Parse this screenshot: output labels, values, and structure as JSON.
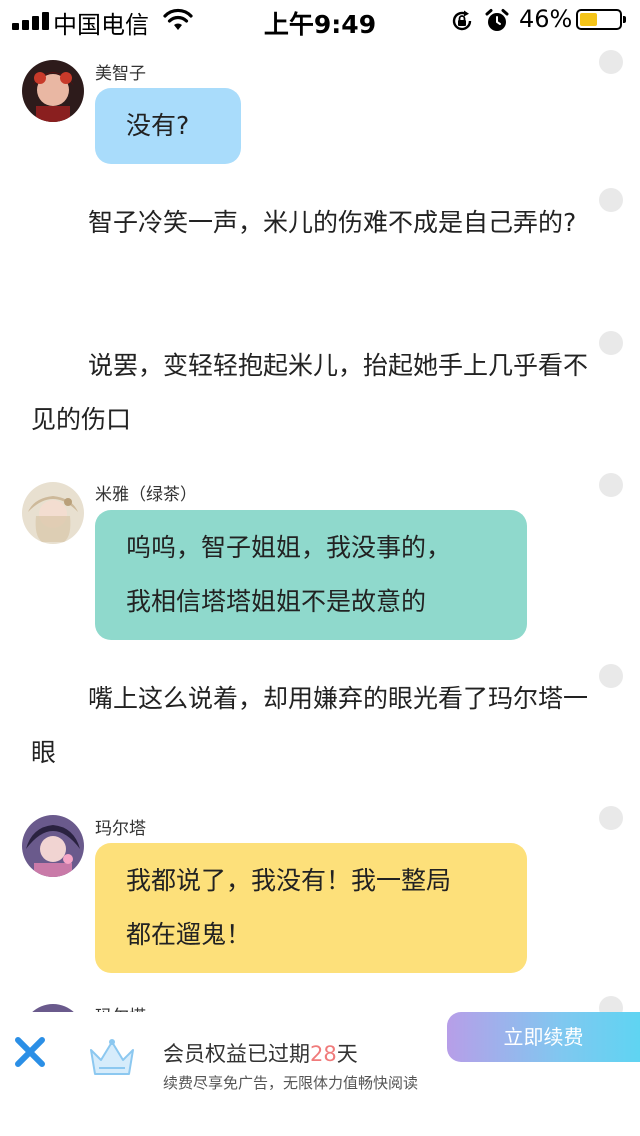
{
  "status_bar": {
    "carrier": "中国电信",
    "time": "上午9:49",
    "battery_percent": "46%",
    "battery_level": 0.46
  },
  "chat": {
    "entry1": {
      "speaker": "美智子",
      "text": "没有?"
    },
    "narration1": "智子冷笑一声，米儿的伤难不成是自己弄的?",
    "narration2": "说罢，变轻轻抱起米儿，抬起她手上几乎看不见的伤口",
    "entry2": {
      "speaker": "米雅（绿茶）",
      "line1": "呜呜，智子姐姐，我没事的，",
      "line2": "我相信塔塔姐姐不是故意的"
    },
    "narration3": "嘴上这么说着，却用嫌弃的眼光看了玛尔塔一眼",
    "entry3": {
      "speaker": "玛尔塔",
      "line1": "我都说了，我没有！我一整局",
      "line2": "都在遛鬼！"
    },
    "entry4": {
      "speaker": "玛尔塔"
    }
  },
  "banner": {
    "title_prefix": "会员权益已过期",
    "days": "28",
    "title_suffix": "天",
    "subtitle": "续费尽享免广告，无限体力值畅快阅读",
    "renew_label": "立即续费"
  },
  "colors": {
    "bubble_blue": "#a9dcfb",
    "bubble_teal": "#8fd9cc",
    "bubble_yellow": "#fde07a",
    "accent_pink": "#f07b7b",
    "close_blue": "#2b8fe6"
  },
  "icons": [
    "signal-icon",
    "wifi-icon",
    "rotation-lock-icon",
    "alarm-icon",
    "battery-icon",
    "close-icon",
    "crown-icon"
  ]
}
